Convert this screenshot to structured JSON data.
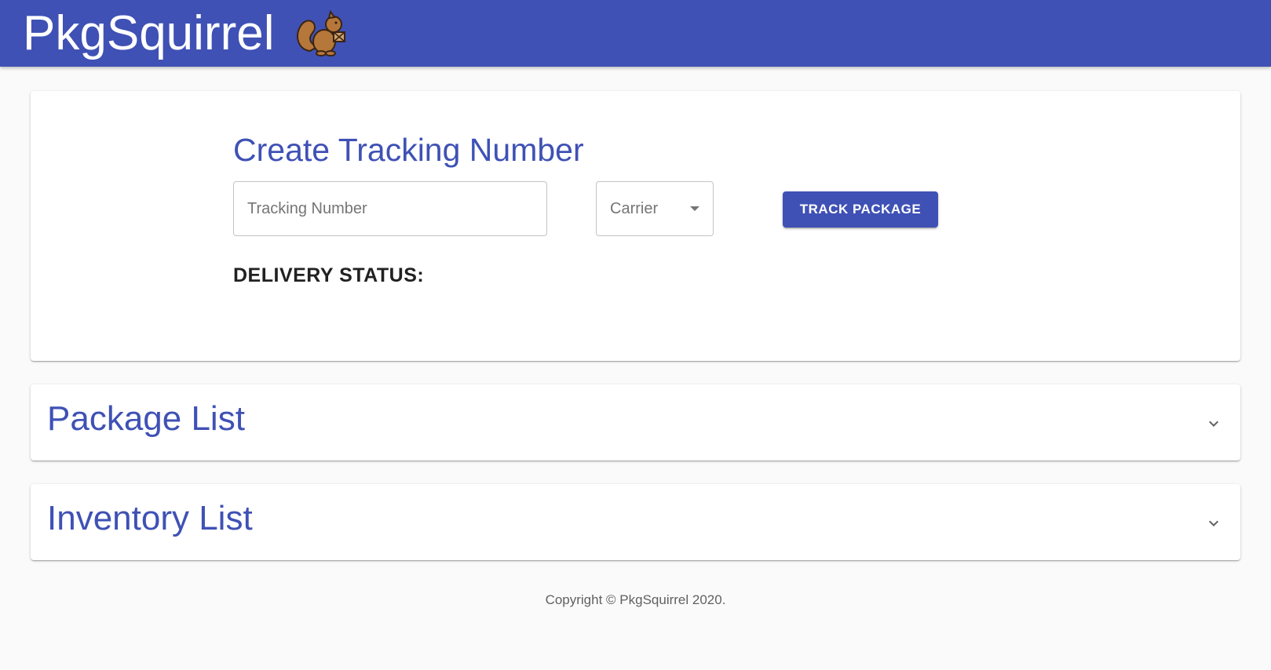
{
  "header": {
    "title": "PkgSquirrel",
    "logo": "squirrel-with-package-icon",
    "color": "#3f51b5"
  },
  "create": {
    "title": "Create Tracking Number",
    "tracking_placeholder": "Tracking Number",
    "tracking_value": "",
    "carrier_label": "Carrier",
    "track_button": "TRACK PACKAGE",
    "delivery_status_label": "DELIVERY STATUS:"
  },
  "accordions": {
    "packages_title": "Package List",
    "inventory_title": "Inventory List",
    "expand_icon": "chevron-down-icon"
  },
  "footer": {
    "copyright": "Copyright © PkgSquirrel 2020."
  },
  "colors": {
    "primary": "#3f51b5",
    "background": "#fafafa"
  }
}
